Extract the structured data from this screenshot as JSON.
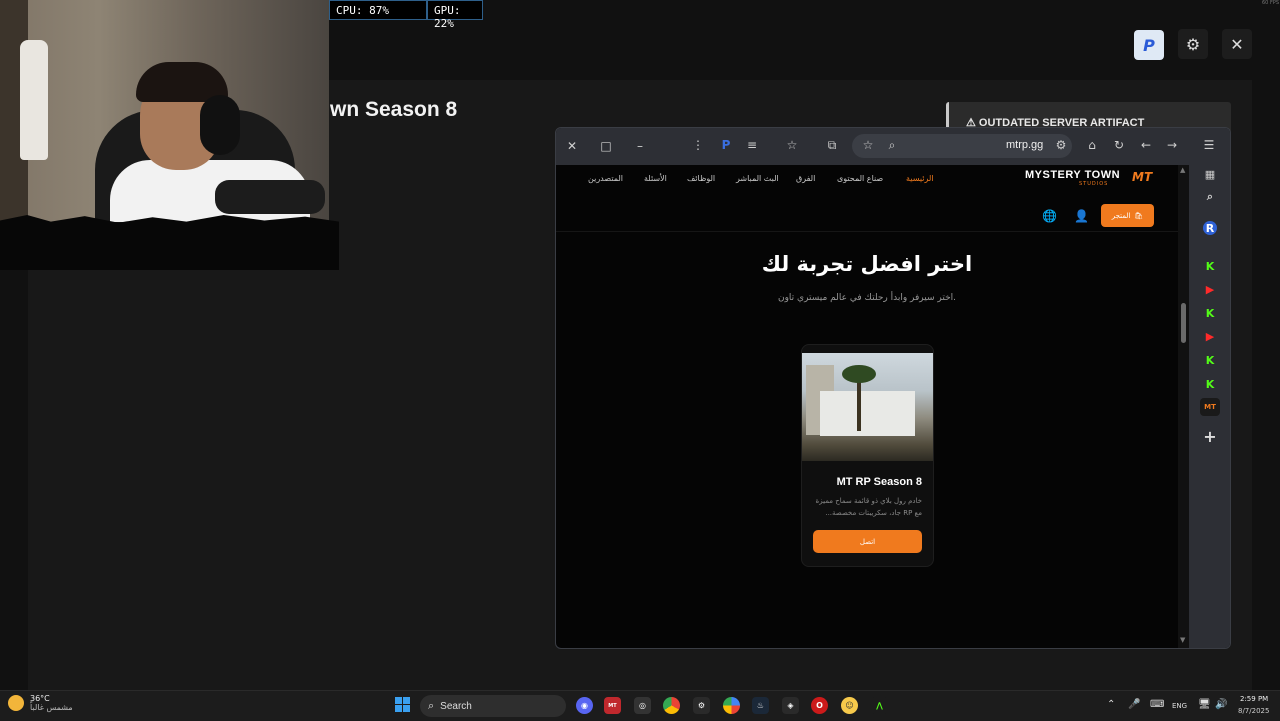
{
  "overlay": {
    "cpu_label": "CPU: 87%",
    "gpu_label": "GPU: 22%",
    "fps_label": "60 FPS"
  },
  "app": {
    "server_title": "wn Season 8",
    "warning": "OUTDATED SERVER ARTIFACT",
    "avatar_letter": "P",
    "settings_icon": "gear-icon",
    "close_icon": "close-icon"
  },
  "browser": {
    "url": "mtrp.gg",
    "sidebar_items": [
      "grid-icon",
      "search-panel-icon",
      "R",
      "K",
      "▶",
      "K",
      "▶",
      "K",
      "K",
      "MT",
      "+"
    ]
  },
  "site": {
    "brand": "MYSTERY TOWN",
    "brand_sub": "STUDIOS",
    "brand_logo": "MT",
    "nav": {
      "home": "الرئيسية",
      "creators": "صناع المحتوى",
      "teams": "الفرق",
      "live": "البث المباشر",
      "jobs": "الوظائف",
      "faq": "الأسئلة",
      "leaders": "المتصدرين"
    },
    "store_label": "المتجر",
    "hero_title": "اختر افضل تجربة لك",
    "hero_subtitle": "اختر سيرفر وابدأ رحلتك في عالم ميستري تاون.",
    "card": {
      "title": "MT RP Season 8",
      "desc": "خادم رول بلاي ذو قائمة سماح مميزة مع RP جاد، سكريبتات مخصصة...",
      "connect_label": "اتصل"
    }
  },
  "taskbar": {
    "weather_temp": "36°C",
    "weather_desc": "مشمس غالباً",
    "search_label": "Search",
    "lang": "ENG",
    "time": "2:59 PM",
    "date": "8/7/2025"
  }
}
